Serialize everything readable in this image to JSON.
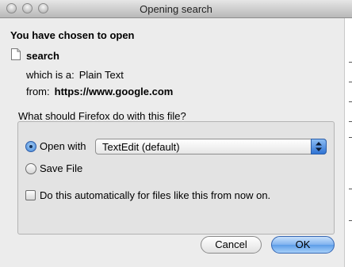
{
  "window": {
    "title": "Opening search"
  },
  "dialog": {
    "heading": "You have chosen to open",
    "file_name": "search",
    "type_label": "which is a:",
    "type_value": "Plain Text",
    "from_label": "from:",
    "from_value": "https://www.google.com",
    "question": "What should Firefox do with this file?",
    "open_with_label": "Open with",
    "open_with_app": "TextEdit (default)",
    "save_file_label": "Save File",
    "auto_label": "Do this automatically for files like this from now on.",
    "selected_action": "open_with",
    "auto_checked": false
  },
  "buttons": {
    "cancel": "Cancel",
    "ok": "OK"
  }
}
